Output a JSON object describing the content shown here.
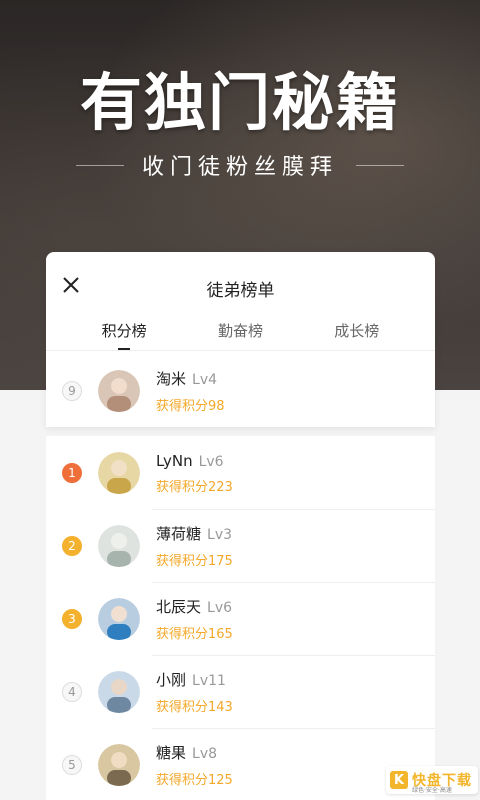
{
  "hero": {
    "title": "有独门秘籍",
    "subtitle": "收门徒粉丝膜拜"
  },
  "card": {
    "title": "徒弟榜单",
    "tabs": [
      {
        "label": "积分榜",
        "active": true
      },
      {
        "label": "勤奋榜",
        "active": false
      },
      {
        "label": "成长榜",
        "active": false
      }
    ]
  },
  "self": {
    "rank": "9",
    "name": "淘米",
    "level": "Lv4",
    "points": "获得积分98"
  },
  "list": [
    {
      "rank": "1",
      "name": "LyNn",
      "level": "Lv6",
      "points": "获得积分223"
    },
    {
      "rank": "2",
      "name": "薄荷糖",
      "level": "Lv3",
      "points": "获得积分175"
    },
    {
      "rank": "3",
      "name": "北辰天",
      "level": "Lv6",
      "points": "获得积分165"
    },
    {
      "rank": "4",
      "name": "小刚",
      "level": "Lv11",
      "points": "获得积分143"
    },
    {
      "rank": "5",
      "name": "糖果",
      "level": "Lv8",
      "points": "获得积分125"
    }
  ],
  "watermark": {
    "mark": "K",
    "name": "快盘下载",
    "tagline": "绿色·安全·高速"
  },
  "colors": {
    "accent": "#f4a82a",
    "rank1": "#ef6f3b",
    "rank2": "#f4b12e",
    "rank3": "#f4b12e"
  }
}
